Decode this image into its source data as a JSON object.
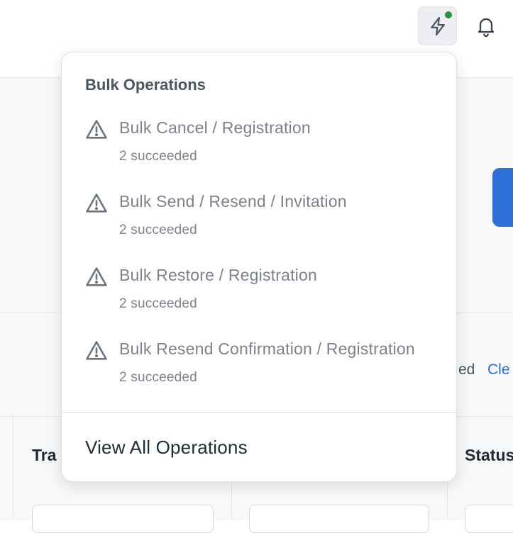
{
  "header": {
    "operations_icon": "lightning-bolt-icon",
    "operations_status_color": "#2f8f3d",
    "notifications_icon": "bell-icon"
  },
  "toolbar": {
    "filter_status_text": "ed",
    "clear_link_text": "Cle"
  },
  "table": {
    "columns": [
      {
        "label": "Tra"
      },
      {
        "label": ""
      },
      {
        "label": "Status"
      }
    ]
  },
  "bulk_operations": {
    "title": "Bulk Operations",
    "items": [
      {
        "icon": "warning-triangle-icon",
        "title": "Bulk Cancel / Registration",
        "status": "2 succeeded"
      },
      {
        "icon": "warning-triangle-icon",
        "title": "Bulk Send / Resend / Invitation",
        "status": "2 succeeded"
      },
      {
        "icon": "warning-triangle-icon",
        "title": "Bulk Restore / Registration",
        "status": "2 succeeded"
      },
      {
        "icon": "warning-triangle-icon",
        "title": "Bulk Resend Confirmation / Registration",
        "status": "2 succeeded"
      }
    ],
    "view_all_label": "View All Operations"
  },
  "colors": {
    "accent": "#2f6fd8",
    "muted_text": "#7c818b",
    "heading_text": "#4b5563"
  }
}
